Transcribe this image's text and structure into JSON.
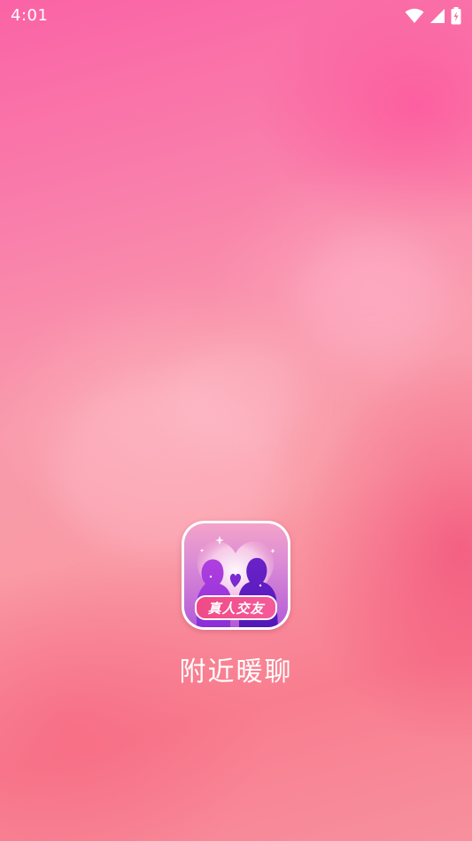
{
  "status_bar": {
    "time": "4:01",
    "icons": [
      "wifi-icon",
      "cell-signal-icon",
      "battery-charging-icon"
    ]
  },
  "splash": {
    "icon_badge_text": "真人交友",
    "app_name": "附近暖聊"
  },
  "colors": {
    "background_top": "#fa63a6",
    "background_mid": "#f99aab",
    "background_bottom": "#f87d8f",
    "badge": "#f04a86",
    "text": "#ffffff"
  }
}
